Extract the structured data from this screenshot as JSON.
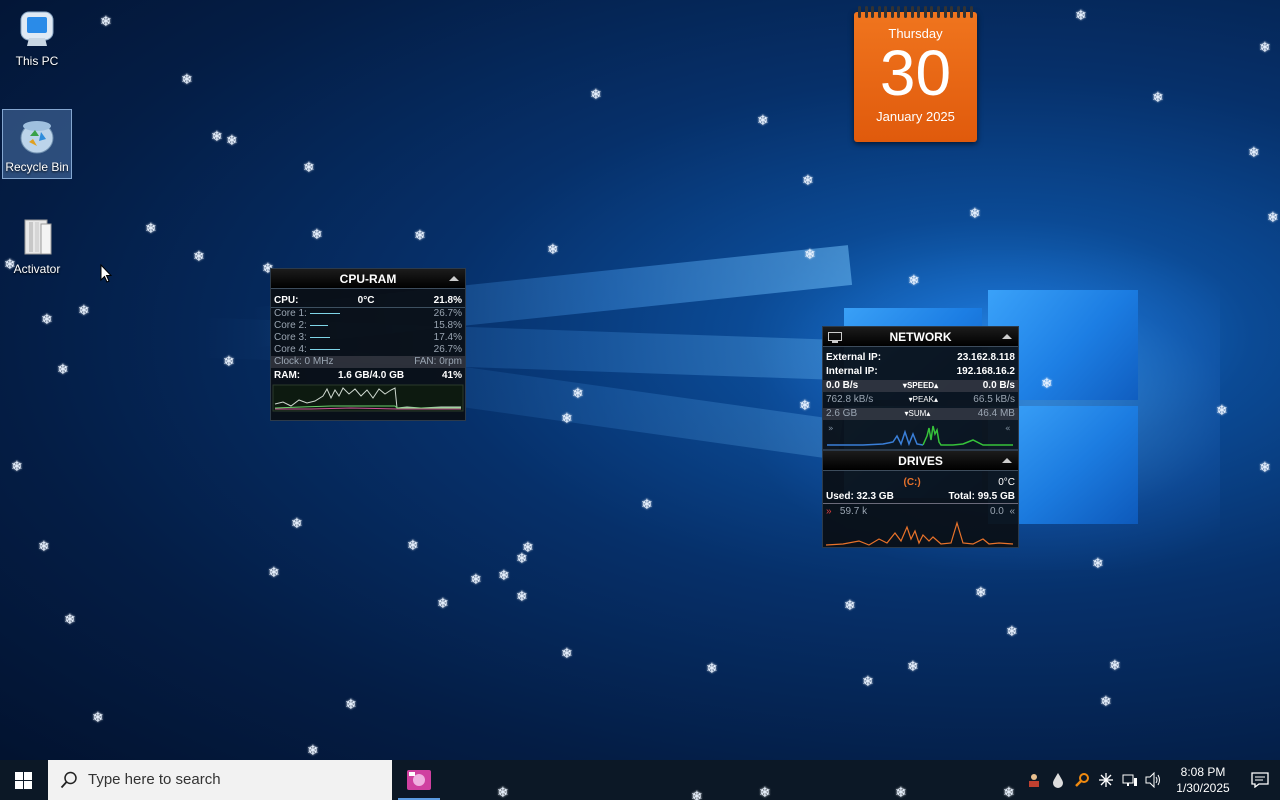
{
  "desktop": {
    "icons": [
      {
        "label": "This PC"
      },
      {
        "label": "Recycle Bin"
      },
      {
        "label": "Activator"
      }
    ]
  },
  "calendar": {
    "weekday": "Thursday",
    "day": "30",
    "month_year": "January 2025"
  },
  "cpu_ram": {
    "title": "CPU-RAM",
    "cpu_label": "CPU:",
    "cpu_temp": "0°C",
    "cpu_usage": "21.8%",
    "cores": [
      {
        "label": "Core 1:",
        "value": "26.7%"
      },
      {
        "label": "Core 2:",
        "value": "15.8%"
      },
      {
        "label": "Core 3:",
        "value": "17.4%"
      },
      {
        "label": "Core 4:",
        "value": "26.7%"
      }
    ],
    "clock": "Clock: 0 MHz",
    "fan": "FAN: 0rpm",
    "ram_label": "RAM:",
    "ram_used": "1.6 GB/4.0 GB",
    "ram_pct": "41%"
  },
  "network": {
    "title": "NETWORK",
    "external_ip_label": "External IP:",
    "external_ip": "23.162.8.118",
    "internal_ip_label": "Internal IP:",
    "internal_ip": "192.168.16.2",
    "speed_down": "0.0 B/s",
    "speed_label": "SPEED",
    "speed_up": "0.0 B/s",
    "peak_down": "762.8 kB/s",
    "peak_label": "PEAK",
    "peak_up": "66.5 kB/s",
    "sum_down": "2.6 GB",
    "sum_label": "SUM",
    "sum_up": "46.4 MB"
  },
  "drives": {
    "title": "DRIVES",
    "drive_letter": "(C:)",
    "temp": "0°C",
    "used": "Used: 32.3 GB",
    "total": "Total: 99.5 GB",
    "read": "59.7 k",
    "write": "0.0"
  },
  "taskbar": {
    "search_placeholder": "Type here to search",
    "time": "8:08 PM",
    "date": "1/30/2025"
  }
}
